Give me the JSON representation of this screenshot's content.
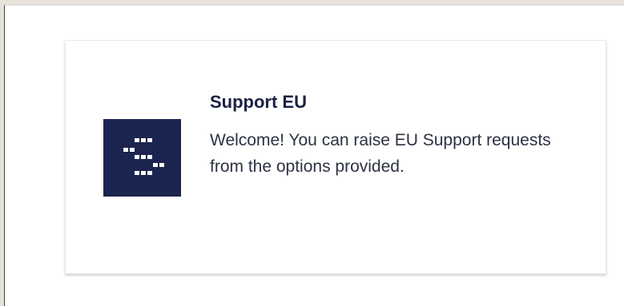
{
  "card": {
    "logo_icon": "support-eu-logo-icon",
    "title": "Support EU",
    "description": "Welcome! You can raise EU Support requests from the options provided."
  },
  "colors": {
    "logo_background": "#1c2550",
    "title_text": "#1c2145",
    "body_text": "#2d3243"
  }
}
